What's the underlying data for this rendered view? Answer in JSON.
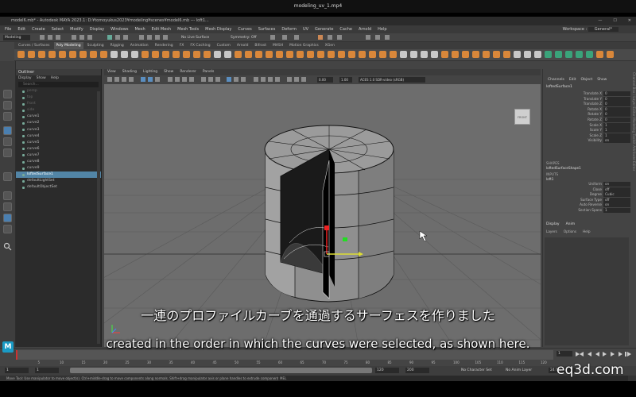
{
  "player": {
    "title": "modeling_uv_1.mp4"
  },
  "window": {
    "title": "model6.mb* - Autodesk MAYA 2023.1: D:¥tomoyukus2023¥modeling¥scenes¥model6.mb --- loft1...",
    "minimize": "—",
    "maximize": "☐",
    "close": "✕"
  },
  "menubar": [
    "File",
    "Edit",
    "Create",
    "Select",
    "Modify",
    "Display",
    "Windows",
    "Mesh",
    "Edit Mesh",
    "Mesh Tools",
    "Mesh Display",
    "Curves",
    "Surfaces",
    "Deform",
    "UV",
    "Generate",
    "Cache",
    "Arnold",
    "Help"
  ],
  "workspace": {
    "label": "Workspace :",
    "value": "General*"
  },
  "statusline": {
    "mode": "Modeling",
    "live_surface": "No Live Surface",
    "symmetry": "Symmetry: Off"
  },
  "shelf_tabs": [
    "Curves / Surfaces",
    "Poly Modeling",
    "Sculpting",
    "Rigging",
    "Animation",
    "Rendering",
    "FX",
    "FX Caching",
    "Custom",
    "Arnold",
    "Bifrost",
    "MASH",
    "Motion Graphics",
    "XGen"
  ],
  "shelf_active": "Poly Modeling",
  "outliner": {
    "title": "Outliner",
    "menu": [
      "Display",
      "Show",
      "Help"
    ],
    "search_placeholder": "Search...",
    "items": [
      {
        "label": "persp",
        "dim": true
      },
      {
        "label": "top",
        "dim": true
      },
      {
        "label": "front",
        "dim": true
      },
      {
        "label": "side",
        "dim": true
      },
      {
        "label": "curve1"
      },
      {
        "label": "curve2"
      },
      {
        "label": "curve3"
      },
      {
        "label": "curve4"
      },
      {
        "label": "curve5"
      },
      {
        "label": "curve6"
      },
      {
        "label": "curve7"
      },
      {
        "label": "curve8"
      },
      {
        "label": "curve9"
      },
      {
        "label": "loftedSurface1",
        "selected": true
      },
      {
        "label": "defaultLightSet"
      },
      {
        "label": "defaultObjectSet"
      }
    ]
  },
  "viewport": {
    "menu": [
      "View",
      "Shading",
      "Lighting",
      "Show",
      "Renderer",
      "Panels"
    ],
    "field1": "0.00",
    "field2": "1.00",
    "colorspace": "ACES 1.0 SDR-video (sRGB)",
    "camera_label": "persp",
    "viewcube": "FRONT"
  },
  "channelbox": {
    "tabs": [
      "Channels",
      "Edit",
      "Object",
      "Show"
    ],
    "object": "loftedSurface1",
    "channels": [
      {
        "label": "Translate X",
        "value": "0"
      },
      {
        "label": "Translate Y",
        "value": "0"
      },
      {
        "label": "Translate Z",
        "value": "0"
      },
      {
        "label": "Rotate X",
        "value": "0"
      },
      {
        "label": "Rotate Y",
        "value": "0"
      },
      {
        "label": "Rotate Z",
        "value": "0"
      },
      {
        "label": "Scale X",
        "value": "1"
      },
      {
        "label": "Scale Y",
        "value": "1"
      },
      {
        "label": "Scale Z",
        "value": "1"
      },
      {
        "label": "Visibility",
        "value": "on"
      }
    ],
    "shapes_header": "SHAPES",
    "shape_name": "loftedSurfaceShape1",
    "inputs_header": "INPUTS",
    "input_name": "loft1",
    "inputs": [
      {
        "label": "Uniform",
        "value": "on"
      },
      {
        "label": "Close",
        "value": "off"
      },
      {
        "label": "Degree",
        "value": "Cubic"
      },
      {
        "label": "Surface Type",
        "value": "off"
      },
      {
        "label": "Auto Reverse",
        "value": "on"
      },
      {
        "label": "Section Spans",
        "value": "1"
      }
    ],
    "layer_tabs": [
      "Display",
      "Anim"
    ],
    "layer_menu": [
      "Layers",
      "Options",
      "Help"
    ],
    "side_tabs": "Channel Box / Layer Editor    Modeling Toolkit    Attribute Editor"
  },
  "timeline": {
    "ticks": [
      "5",
      "10",
      "15",
      "20",
      "25",
      "30",
      "35",
      "40",
      "45",
      "50",
      "55",
      "60",
      "65",
      "70",
      "75",
      "80",
      "85",
      "90",
      "95",
      "100",
      "105",
      "110",
      "115",
      "120"
    ],
    "current": "1",
    "start": "1",
    "end": "120",
    "range_end": "120",
    "anim_end": "200",
    "character_set": "No Character Set",
    "anim_layer": "No Anim Layer",
    "fps": "24 fps"
  },
  "cmdline": {
    "label": "MEL"
  },
  "helpline": "Move Tool: Use manipulator to move object(s). Ctrl+middle-drag to move components along normals. Shift+drag manipulator axis or plane handles to extrude components or c",
  "subtitles": {
    "jp": "一連のプロファイルカーブを通過するサーフェスを作りました",
    "en": "created in the order in which the curves were selected, as shown here."
  },
  "watermark": "eq3d.com",
  "colors": {
    "accent": "#5285a6",
    "maya_blue": "#1a9bc5",
    "viewport_bg": "#6d6d6d"
  }
}
